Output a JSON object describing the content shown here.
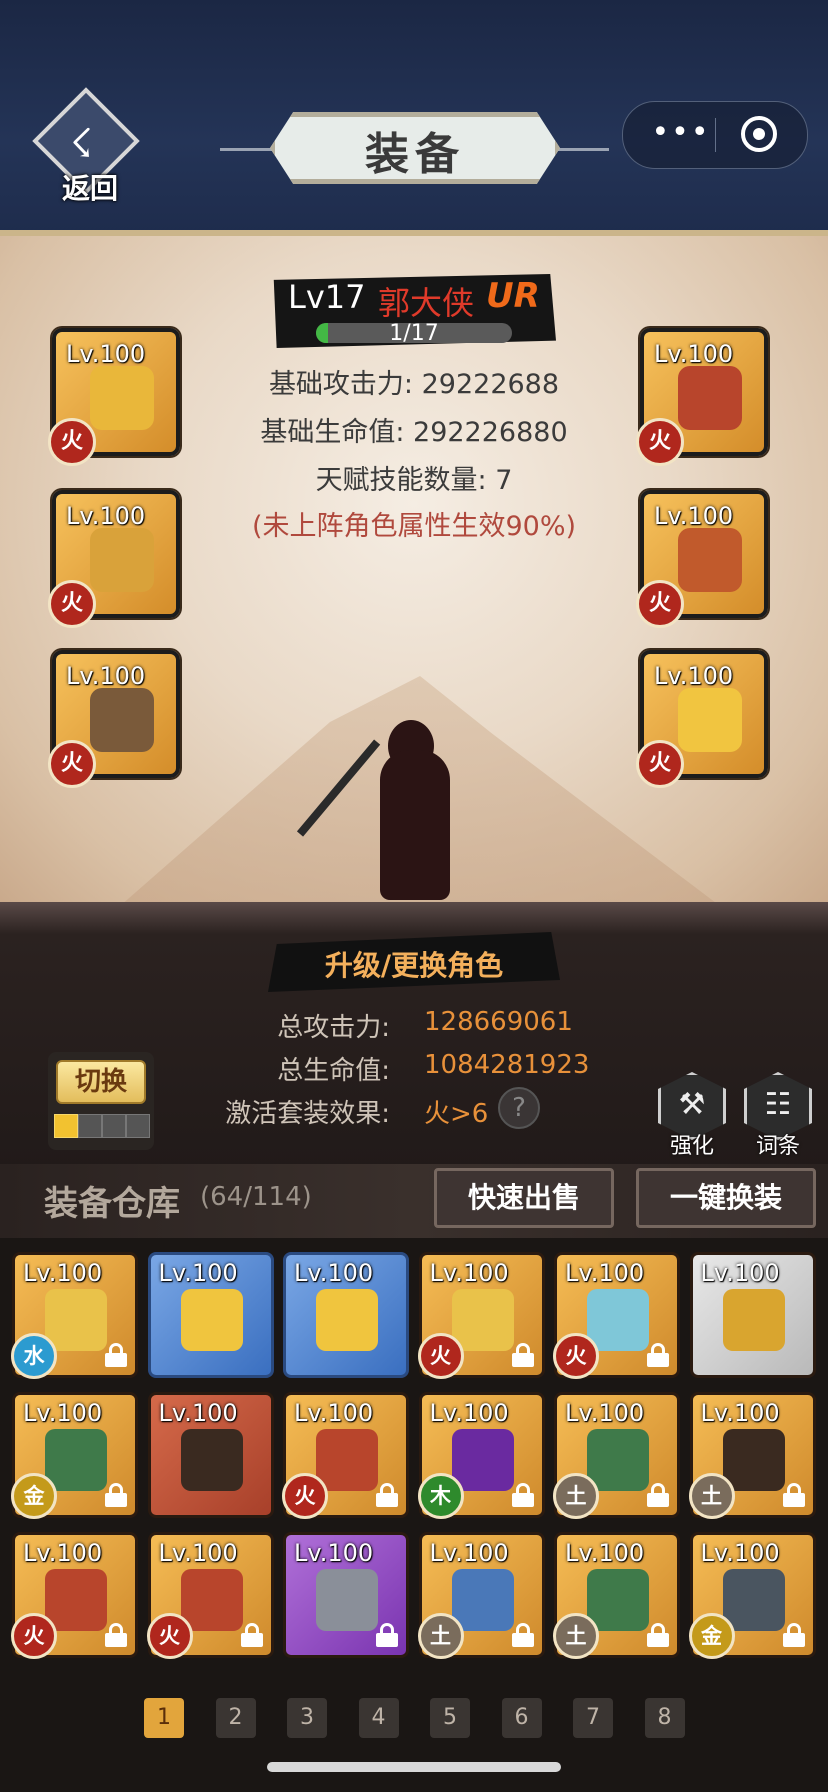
{
  "header": {
    "back_label": "返回",
    "back_glyph": "☇",
    "title": "装备",
    "more_glyph": "•••"
  },
  "character": {
    "level": "Lv17",
    "name": "郭大侠",
    "rarity": "UR",
    "exp_text": "1/17",
    "exp_progress": 0.06,
    "base_attack": "基础攻击力: 29222688",
    "base_hp": "基础生命值: 292226880",
    "talent_count": "天赋技能数量: 7",
    "note": "(未上阵角色属性生效90%)"
  },
  "equipped": {
    "left": [
      {
        "level": "Lv.100",
        "element": "火",
        "icon": "golden-sword-icon",
        "color": "#e9b73a"
      },
      {
        "level": "Lv.100",
        "element": "火",
        "icon": "jeweled-helmet-icon",
        "color": "#d9a23a"
      },
      {
        "level": "Lv.100",
        "element": "火",
        "icon": "amulet-icon",
        "color": "#7a5a3a"
      }
    ],
    "right": [
      {
        "level": "Lv.100",
        "element": "火",
        "icon": "red-armor-icon",
        "color": "#b8452c"
      },
      {
        "level": "Lv.100",
        "element": "火",
        "icon": "boots-icon",
        "color": "#c15a2c"
      },
      {
        "level": "Lv.100",
        "element": "火",
        "icon": "ring-icon",
        "color": "#f1c540"
      }
    ]
  },
  "actions": {
    "upgrade_label": "升级/更换角色",
    "switch_label": "切换",
    "enhance_label": "强化",
    "enhance_glyph": "⚒",
    "affix_label": "词条",
    "affix_glyph": "☷",
    "help_glyph": "?"
  },
  "totals": {
    "attack_label": "总攻击力:",
    "attack_value": "128669061",
    "hp_label": "总生命值:",
    "hp_value": "1084281923",
    "set_label": "激活套装效果:",
    "set_value": "火>6"
  },
  "warehouse": {
    "title": "装备仓库",
    "count": "(64/114)",
    "quick_sell_label": "快速出售",
    "one_click_equip_label": "一键换装",
    "items": [
      {
        "level": "Lv.100",
        "element": "水",
        "locked": true,
        "rarity": "orange",
        "icon": "golden-sword-icon",
        "art": "#e9c24a"
      },
      {
        "level": "Lv.100",
        "element": "",
        "locked": false,
        "rarity": "blue",
        "icon": "golden-blade-icon",
        "art": "#f0c53e"
      },
      {
        "level": "Lv.100",
        "element": "",
        "locked": false,
        "rarity": "blue",
        "icon": "golden-blade-icon",
        "art": "#f0c53e"
      },
      {
        "level": "Lv.100",
        "element": "火",
        "locked": true,
        "rarity": "orange",
        "icon": "golden-sword-icon",
        "art": "#e9c24a"
      },
      {
        "level": "Lv.100",
        "element": "火",
        "locked": true,
        "rarity": "orange",
        "icon": "ice-spear-icon",
        "art": "#7fc7d8"
      },
      {
        "level": "Lv.100",
        "element": "",
        "locked": false,
        "rarity": "silver",
        "icon": "golden-sword-icon",
        "art": "#d9a52f"
      },
      {
        "level": "Lv.100",
        "element": "金",
        "locked": true,
        "rarity": "orange",
        "icon": "green-armor-icon",
        "art": "#3f7a4a"
      },
      {
        "level": "Lv.100",
        "element": "",
        "locked": false,
        "rarity": "red",
        "icon": "dark-helmet-icon",
        "art": "#3a2a20"
      },
      {
        "level": "Lv.100",
        "element": "火",
        "locked": true,
        "rarity": "orange",
        "icon": "red-armor-icon",
        "art": "#b8452c"
      },
      {
        "level": "Lv.100",
        "element": "木",
        "locked": true,
        "rarity": "orange",
        "icon": "purple-armor-icon",
        "art": "#6a2aa0"
      },
      {
        "level": "Lv.100",
        "element": "土",
        "locked": true,
        "rarity": "orange",
        "icon": "green-armor-icon",
        "art": "#3f7a4a"
      },
      {
        "level": "Lv.100",
        "element": "土",
        "locked": true,
        "rarity": "orange",
        "icon": "dark-helmet-icon",
        "art": "#3a2a20"
      },
      {
        "level": "Lv.100",
        "element": "火",
        "locked": true,
        "rarity": "orange",
        "icon": "red-armor-icon",
        "art": "#b8452c"
      },
      {
        "level": "Lv.100",
        "element": "火",
        "locked": true,
        "rarity": "orange",
        "icon": "red-armor-icon",
        "art": "#b8452c"
      },
      {
        "level": "Lv.100",
        "element": "",
        "locked": true,
        "rarity": "purple",
        "icon": "steel-armor-icon",
        "art": "#8a8f99"
      },
      {
        "level": "Lv.100",
        "element": "土",
        "locked": true,
        "rarity": "orange",
        "icon": "blue-armor-icon",
        "art": "#4a78b8"
      },
      {
        "level": "Lv.100",
        "element": "土",
        "locked": true,
        "rarity": "orange",
        "icon": "green-armor-icon",
        "art": "#3f7a4a"
      },
      {
        "level": "Lv.100",
        "element": "金",
        "locked": true,
        "rarity": "orange",
        "icon": "grey-armor-icon",
        "art": "#4a5560"
      }
    ]
  },
  "pagination": {
    "pages": [
      "1",
      "2",
      "3",
      "4",
      "5",
      "6",
      "7",
      "8"
    ],
    "current": "1"
  },
  "colors": {
    "header_bg": "#243457",
    "accent_orange": "#e8913a",
    "name_red": "#e03a2a"
  }
}
